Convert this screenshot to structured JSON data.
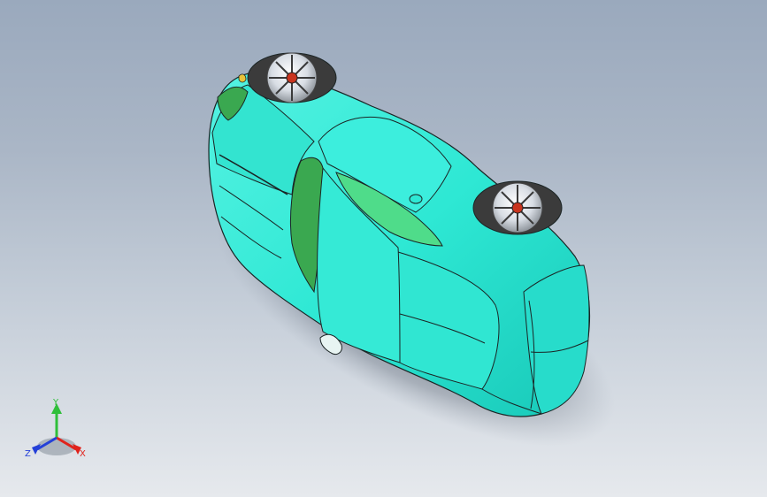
{
  "viewport": {
    "background_top": "#9aa9bd",
    "background_bottom": "#e6e9ed"
  },
  "model": {
    "body_color": "#2ee8d4",
    "glass_color": "#4fdc8a",
    "shade_color": "#3aa850",
    "edge_color": "#1b2424",
    "tire_color": "#3b3b3b",
    "rim_color": "#e0e4ea"
  },
  "triad": {
    "x_label": "X",
    "y_label": "Y",
    "z_label": "Z",
    "x_color": "#e0231c",
    "y_color": "#2fbf3a",
    "z_color": "#2440d8"
  }
}
